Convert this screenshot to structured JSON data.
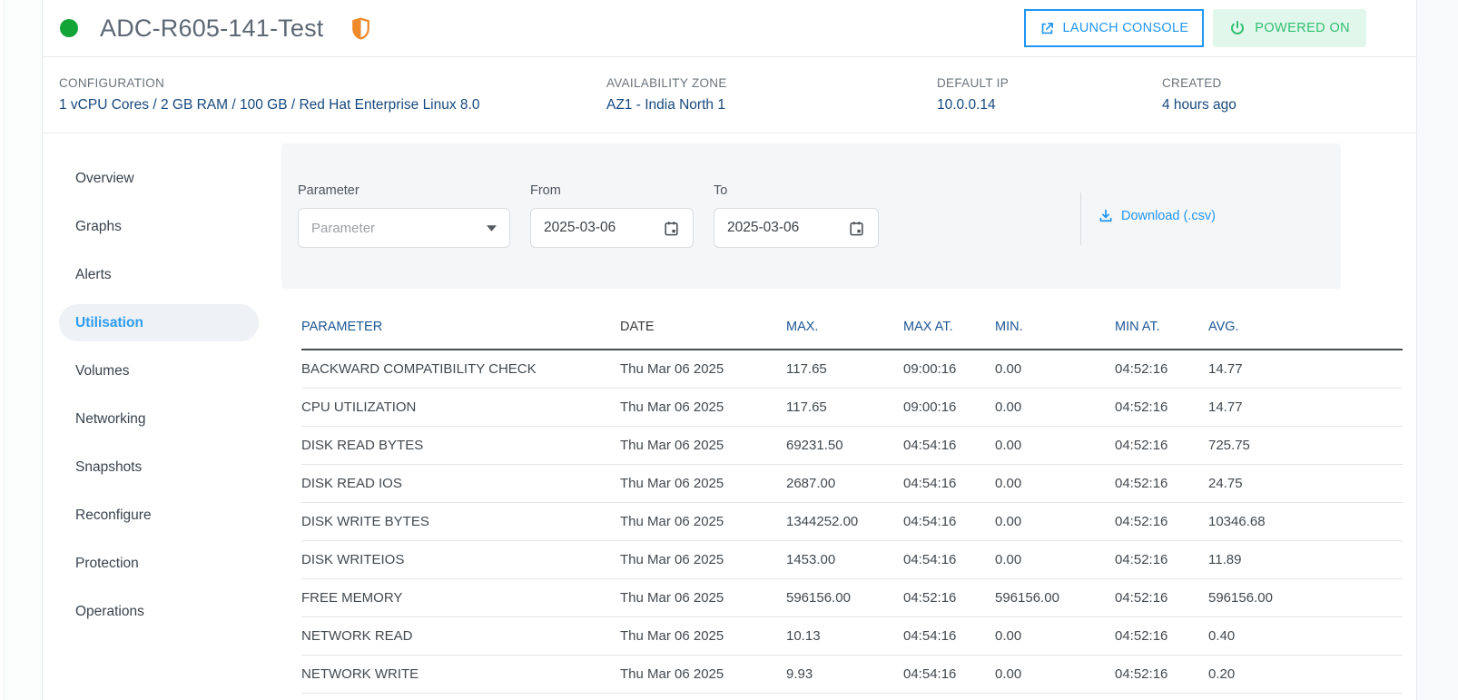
{
  "header": {
    "title": "ADC-R605-141-Test",
    "status": "running",
    "status_dot_icon": "green-circle",
    "shield_icon": "shield-half-icon",
    "launch_console_label": "LAUNCH CONSOLE",
    "launch_console_icon": "external-link-icon",
    "powered_on_label": "POWERED ON",
    "powered_on_icon": "power-icon"
  },
  "info_bar": {
    "items": [
      {
        "label": "CONFIGURATION",
        "value": "1 vCPU Cores / 2 GB RAM / 100 GB / Red Hat Enterprise Linux 8.0"
      },
      {
        "label": "AVAILABILITY ZONE",
        "value": "AZ1 - India North 1"
      },
      {
        "label": "DEFAULT IP",
        "value": "10.0.0.14"
      },
      {
        "label": "CREATED",
        "value": "4 hours ago"
      }
    ]
  },
  "sidebar": {
    "items": [
      {
        "label": "Overview",
        "active": false
      },
      {
        "label": "Graphs",
        "active": false
      },
      {
        "label": "Alerts",
        "active": false
      },
      {
        "label": "Utilisation",
        "active": true
      },
      {
        "label": "Volumes",
        "active": false
      },
      {
        "label": "Networking",
        "active": false
      },
      {
        "label": "Snapshots",
        "active": false
      },
      {
        "label": "Reconfigure",
        "active": false
      },
      {
        "label": "Protection",
        "active": false
      },
      {
        "label": "Operations",
        "active": false
      }
    ]
  },
  "filters": {
    "parameter_label": "Parameter",
    "parameter_placeholder": "Parameter",
    "parameter_caret_icon": "chevron-down-icon",
    "from_label": "From",
    "from_value": "2025-03-06",
    "to_label": "To",
    "to_value": "2025-03-06",
    "calendar_icon": "calendar-icon",
    "download_label": "Download (.csv)",
    "download_icon": "download-icon"
  },
  "table": {
    "columns": [
      {
        "label": "PARAMETER",
        "sortable": true
      },
      {
        "label": "DATE",
        "sortable": false
      },
      {
        "label": "MAX.",
        "sortable": true
      },
      {
        "label": "MAX AT.",
        "sortable": true
      },
      {
        "label": "MIN.",
        "sortable": true
      },
      {
        "label": "MIN AT.",
        "sortable": true
      },
      {
        "label": "AVG.",
        "sortable": true
      }
    ],
    "rows": [
      [
        "BACKWARD COMPATIBILITY CHECK",
        "Thu Mar 06 2025",
        "117.65",
        "09:00:16",
        "0.00",
        "04:52:16",
        "14.77"
      ],
      [
        "CPU UTILIZATION",
        "Thu Mar 06 2025",
        "117.65",
        "09:00:16",
        "0.00",
        "04:52:16",
        "14.77"
      ],
      [
        "DISK READ BYTES",
        "Thu Mar 06 2025",
        "69231.50",
        "04:54:16",
        "0.00",
        "04:52:16",
        "725.75"
      ],
      [
        "DISK READ IOS",
        "Thu Mar 06 2025",
        "2687.00",
        "04:54:16",
        "0.00",
        "04:52:16",
        "24.75"
      ],
      [
        "DISK WRITE BYTES",
        "Thu Mar 06 2025",
        "1344252.00",
        "04:54:16",
        "0.00",
        "04:52:16",
        "10346.68"
      ],
      [
        "DISK WRITEIOS",
        "Thu Mar 06 2025",
        "1453.00",
        "04:54:16",
        "0.00",
        "04:52:16",
        "11.89"
      ],
      [
        "FREE MEMORY",
        "Thu Mar 06 2025",
        "596156.00",
        "04:52:16",
        "596156.00",
        "04:52:16",
        "596156.00"
      ],
      [
        "NETWORK READ",
        "Thu Mar 06 2025",
        "10.13",
        "04:54:16",
        "0.00",
        "04:52:16",
        "0.40"
      ],
      [
        "NETWORK WRITE",
        "Thu Mar 06 2025",
        "9.93",
        "04:54:16",
        "0.00",
        "04:52:16",
        "0.20"
      ]
    ]
  },
  "colors": {
    "status_green": "#13a438",
    "shield_orange": "#ef8b2c",
    "accent_blue": "#2196f3",
    "navy_text": "#17497e",
    "power_green": "#2fbf71",
    "power_green_bg": "#e2f7eb"
  }
}
